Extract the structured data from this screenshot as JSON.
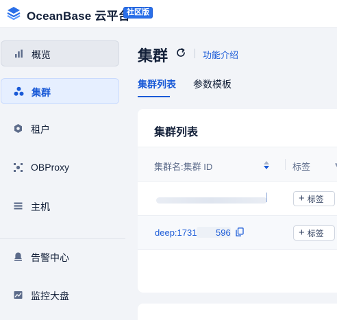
{
  "app": {
    "name": "OceanBase 云平台",
    "edition_badge": "社区版",
    "logo_icon": "oceanbase-logo-icon"
  },
  "colors": {
    "accent": "#1a5ad7",
    "badge_bg": "#2a6fe8",
    "sidebar_bg": "#f2f4f8",
    "active_bg": "#e6efff"
  },
  "sidebar": {
    "items": [
      {
        "label": "概览",
        "icon": "bar-chart-icon",
        "state": "hover"
      },
      {
        "label": "集群",
        "icon": "cluster-icon",
        "state": "active"
      },
      {
        "label": "租户",
        "icon": "tenant-hexagon-icon",
        "state": "normal"
      },
      {
        "label": "OBProxy",
        "icon": "proxy-icon",
        "state": "normal"
      },
      {
        "label": "主机",
        "icon": "host-server-icon",
        "state": "normal"
      },
      {
        "label": "告警中心",
        "icon": "alarm-bell-icon",
        "state": "normal"
      },
      {
        "label": "监控大盘",
        "icon": "monitor-chart-icon",
        "state": "normal"
      }
    ]
  },
  "page": {
    "title": "集群",
    "refresh_icon": "refresh-icon",
    "intro_link": "功能介绍",
    "tabs": [
      {
        "label": "集群列表",
        "active": true
      },
      {
        "label": "参数模板",
        "active": false
      }
    ]
  },
  "table": {
    "title": "集群列表",
    "columns": [
      "集群名:集群 ID",
      "标签"
    ],
    "rows": [
      {
        "name_prefix": "",
        "name_suffix": "",
        "tag_button": "标签",
        "redacted": true
      },
      {
        "name_prefix": "deep:1731",
        "name_suffix": "596",
        "tag_button": "标签",
        "redacted": false
      }
    ]
  }
}
